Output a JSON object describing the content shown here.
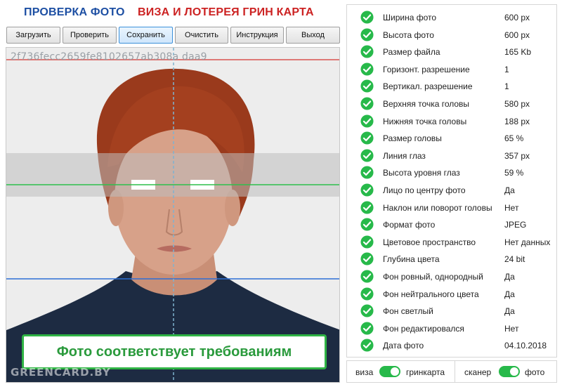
{
  "header": {
    "title_left": "ПРОВЕРКА ФОТО",
    "title_right": "ВИЗА И ЛОТЕРЕЯ ГРИН КАРТА"
  },
  "toolbar": {
    "load": "Загрузить",
    "check": "Проверить",
    "save": "Сохранить",
    "clear": "Очистить",
    "instruction": "Инструкция",
    "exit": "Выход"
  },
  "photo": {
    "hash": "2f736fecc2659fe8102657ab308a daa9",
    "status": "Фото соответствует требованиям",
    "watermark": "GREENCARD.BY"
  },
  "checks": [
    {
      "label": "Ширина фото",
      "value": "600 px"
    },
    {
      "label": "Высота фото",
      "value": "600 px"
    },
    {
      "label": "Размер файла",
      "value": "165 Kb"
    },
    {
      "label": "Горизонт. разрешение",
      "value": "1"
    },
    {
      "label": "Вертикал. разрешение",
      "value": "1"
    },
    {
      "label": "Верхняя точка головы",
      "value": "580 px"
    },
    {
      "label": "Нижняя точка головы",
      "value": "188 px"
    },
    {
      "label": "Размер головы",
      "value": "65 %"
    },
    {
      "label": "Линия глаз",
      "value": "357 px"
    },
    {
      "label": "Высота уровня глаз",
      "value": "59 %"
    },
    {
      "label": "Лицо по центру фото",
      "value": "Да"
    },
    {
      "label": "Наклон или поворот головы",
      "value": "Нет"
    },
    {
      "label": "Формат фото",
      "value": "JPEG"
    },
    {
      "label": "Цветовое пространство",
      "value": "Нет данных"
    },
    {
      "label": "Глубина цвета",
      "value": "24 bit"
    },
    {
      "label": "Фон ровный, однородный",
      "value": "Да"
    },
    {
      "label": "Фон нейтрального цвета",
      "value": "Да"
    },
    {
      "label": "Фон светлый",
      "value": "Да"
    },
    {
      "label": "Фон редактировался",
      "value": "Нет"
    },
    {
      "label": "Дата фото",
      "value": "04.10.2018"
    }
  ],
  "toggles": {
    "visa": "виза",
    "greencard": "гринкарта",
    "scanner": "сканер",
    "photo": "фото"
  },
  "colors": {
    "check_green": "#27b94a",
    "title_blue": "#1d4fa3",
    "title_red": "#cc2222",
    "status_green": "#2fb344"
  }
}
